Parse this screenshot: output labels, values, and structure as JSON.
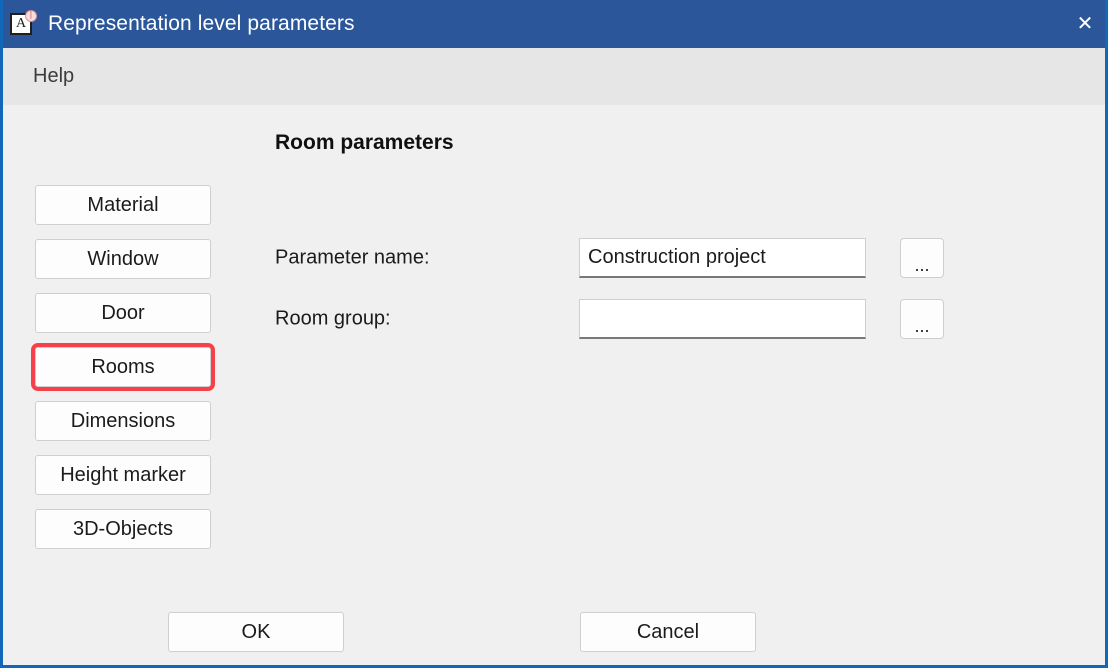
{
  "window": {
    "title": "Representation level parameters",
    "icon_name": "app-sheet-icon",
    "icon_glyph": "A",
    "close_label": "✕",
    "titlebar_color": "#2b579a",
    "border_color": "#1168b8",
    "menubar_color": "#e6e6e6",
    "content_color": "#f0f0f0"
  },
  "menubar": {
    "items": [
      {
        "label": "Help"
      }
    ]
  },
  "sidebar": {
    "selected_index": 3,
    "highlight_color": "#f7414a",
    "items": [
      {
        "label": "Material"
      },
      {
        "label": "Window"
      },
      {
        "label": "Door"
      },
      {
        "label": "Rooms"
      },
      {
        "label": "Dimensions"
      },
      {
        "label": "Height marker"
      },
      {
        "label": "3D-Objects"
      }
    ]
  },
  "main": {
    "heading": "Room parameters",
    "fields": [
      {
        "label": "Parameter name:",
        "value": "Construction project",
        "placeholder": "",
        "browse_label": "..."
      },
      {
        "label": "Room group:",
        "value": "",
        "placeholder": "",
        "browse_label": "..."
      }
    ]
  },
  "footer": {
    "ok_label": "OK",
    "cancel_label": "Cancel"
  }
}
